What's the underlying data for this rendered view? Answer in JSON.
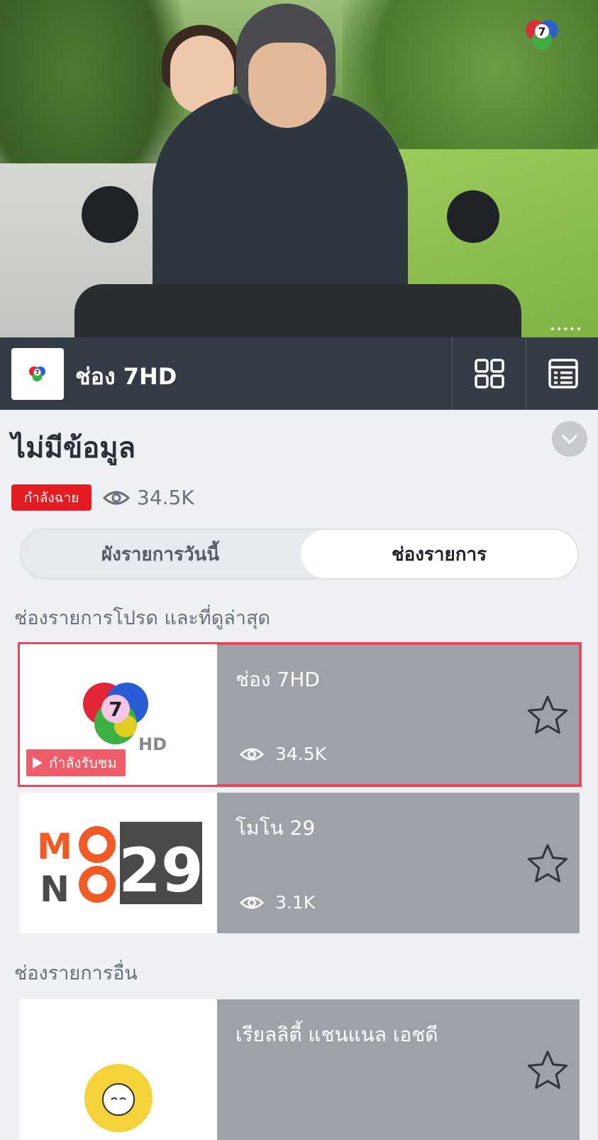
{
  "player": {
    "menu_dots": "•••••"
  },
  "channel_bar": {
    "logo_icon": "ch7-logo-icon",
    "channel_name": "ช่อง 7HD",
    "grid_button_icon": "grid-icon",
    "list_button_icon": "list-icon"
  },
  "program": {
    "title": "ไม่มีข้อมูล",
    "live_badge": "กำลังฉาย",
    "viewer_count": "34.5K"
  },
  "tabs": {
    "today_schedule": "ผังรายการวันนี้",
    "channels": "ช่องรายการ",
    "selected": "channels"
  },
  "sections": {
    "favorites_recent": "ช่องรายการโปรด และที่ดูล่าสุด",
    "other_channels": "ช่องรายการอื่น"
  },
  "favorites": [
    {
      "name": "ช่อง 7HD",
      "views": "34.5K",
      "now_watching": "กำลังรับชม",
      "active": true
    },
    {
      "name": "โมโน 29",
      "views": "3.1K",
      "active": false
    }
  ],
  "others": [
    {
      "name": "เรียลลิตี้ แชนแนล เอชดี"
    }
  ],
  "mono_logo": {
    "letters": [
      "M",
      "O",
      "N",
      "O"
    ],
    "number": "29"
  },
  "colors": {
    "bar": "#333b47",
    "live_red": "#e41b23",
    "active_outline": "#e5495b",
    "card_gray": "#9ea2a8",
    "mono_orange": "#f15a24"
  }
}
